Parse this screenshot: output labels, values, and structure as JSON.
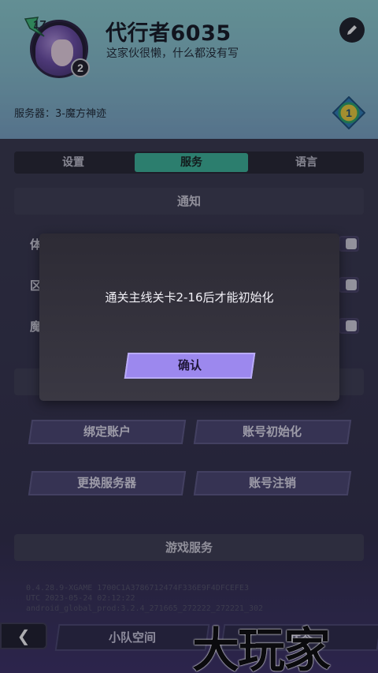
{
  "profile": {
    "level": "17",
    "rank_number": "2",
    "name": "代行者6035",
    "signature": "这家伙很懒，什么都没有写",
    "server": "服务器：3-魔方神迹",
    "emblem_number": "1"
  },
  "tabs": [
    {
      "label": "设置",
      "active": false
    },
    {
      "label": "服务",
      "active": true
    },
    {
      "label": "语言",
      "active": false
    }
  ],
  "sections": {
    "notify": "通知",
    "game_service": "游戏服务"
  },
  "toggles": [
    {
      "label": "体",
      "on": true
    },
    {
      "label": "区",
      "on": true
    },
    {
      "label": "魔",
      "on": true
    }
  ],
  "account_buttons": {
    "bind": "绑定账户",
    "reset": "账号初始化",
    "change_server": "更换服务器",
    "delete": "账号注销"
  },
  "version": {
    "line1": "0.4.28.9-XGAME 1700C1A3786712474F336E9F4DFCEFE3",
    "line2": "UTC 2023-05-24 02:12:22",
    "line3": "android_global_prod:3.2.4_271665_272222_272221_302"
  },
  "bottom_nav": {
    "back": "❮",
    "team_space": "小队空间",
    "right_partial": "状态"
  },
  "dialog": {
    "message": "通关主线关卡2-16后才能初始化",
    "confirm": "确认"
  },
  "watermark": "大玩家",
  "colors": {
    "accent_tab": "#3bb89a",
    "confirm": "#9c88ee",
    "button": "#4a4670"
  }
}
